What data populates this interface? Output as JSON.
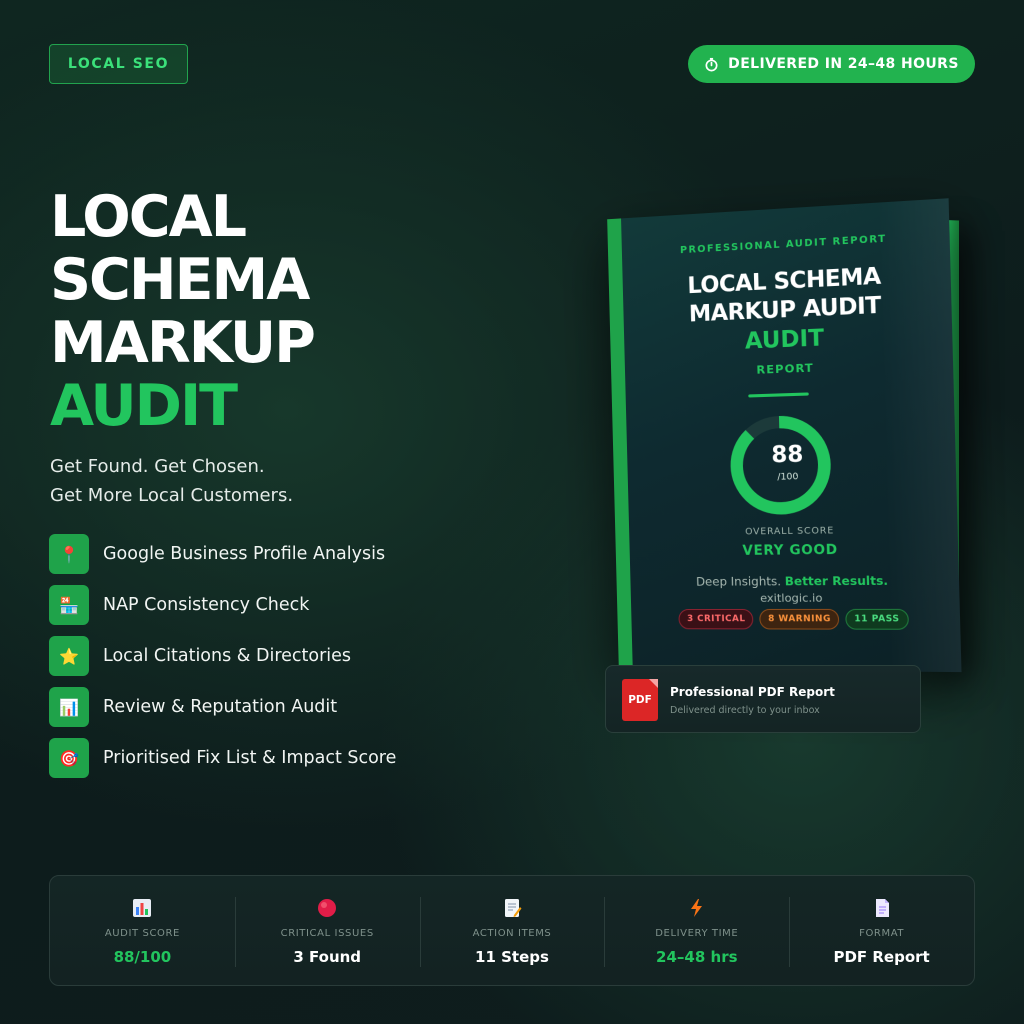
{
  "tag": "LOCAL SEO",
  "delivery_badge": {
    "icon": "timer-icon",
    "label": "DELIVERED IN 24–48 HOURS"
  },
  "hero": {
    "line1": "LOCAL",
    "line2": "SCHEMA",
    "line3": "MARKUP",
    "line4": "AUDIT",
    "subtitle_line1": "Get Found. Get Chosen.",
    "subtitle_line2": "Get More Local Customers."
  },
  "features": [
    {
      "icon": "pin-icon",
      "glyph": "📍",
      "label": "Google Business Profile Analysis"
    },
    {
      "icon": "store-icon",
      "glyph": "🏪",
      "label": "NAP Consistency Check"
    },
    {
      "icon": "star-icon",
      "glyph": "⭐",
      "label": "Local Citations & Directories"
    },
    {
      "icon": "bar-chart-icon",
      "glyph": "📊",
      "label": "Review & Reputation Audit"
    },
    {
      "icon": "target-icon",
      "glyph": "🎯",
      "label": "Prioritised Fix List & Impact Score"
    }
  ],
  "book": {
    "kicker": "PROFESSIONAL AUDIT REPORT",
    "title_line1": "LOCAL SCHEMA",
    "title_line2": "MARKUP AUDIT",
    "audit": "AUDIT",
    "report": "REPORT",
    "score": "88",
    "score_max": "/100",
    "score_fraction": 0.88,
    "overall_label": "OVERALL SCORE",
    "rating": "VERY GOOD",
    "tagline_plain": "Deep Insights.",
    "tagline_green": "Better Results.",
    "site": "exitlogic.io",
    "badges": {
      "critical": "3 CRITICAL",
      "warning": "8 WARNING",
      "pass": "11 PASS"
    },
    "colors": {
      "accent": "#22c55e",
      "critical": "#ff6b6b",
      "warning": "#fb923c"
    }
  },
  "pdf_card": {
    "icon_label": "PDF",
    "title": "Professional PDF Report",
    "subtitle": "Delivered directly to your inbox"
  },
  "stats": [
    {
      "icon": "bar-chart-icon",
      "label": "AUDIT SCORE",
      "value": "88/100"
    },
    {
      "icon": "red-circle-icon",
      "label": "CRITICAL ISSUES",
      "value": "3 Found"
    },
    {
      "icon": "memo-icon",
      "label": "ACTION ITEMS",
      "value": "11 Steps"
    },
    {
      "icon": "lightning-icon",
      "label": "DELIVERY TIME",
      "value": "24–48 hrs"
    },
    {
      "icon": "document-icon",
      "label": "FORMAT",
      "value": "PDF Report"
    }
  ]
}
